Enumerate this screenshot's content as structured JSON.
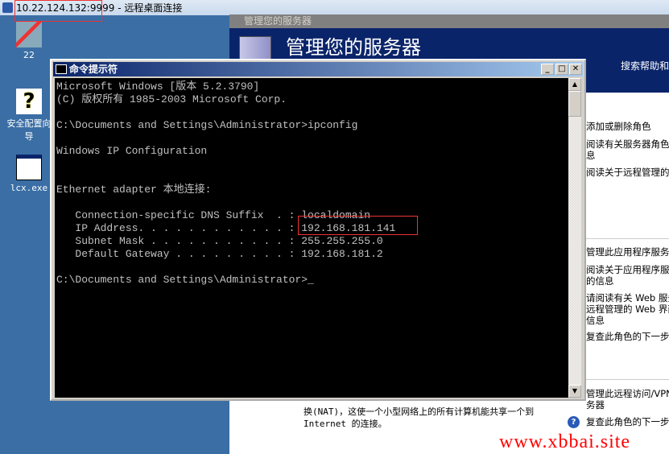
{
  "rdp": {
    "title": "10.22.124.132:9999 - 远程桌面连接"
  },
  "desktop": {
    "icons": [
      {
        "label": "22",
        "icon": "network-computer-icon"
      },
      {
        "label": "安全配置向导",
        "icon": "security-wizard-icon"
      },
      {
        "label": "lcx.exe",
        "icon": "exe-window-icon"
      }
    ]
  },
  "server_manager": {
    "window_title": "管理您的服务器",
    "heading": "管理您的服务器",
    "search_help": "搜索帮助和",
    "right_links": [
      "添加或删除角色",
      "阅读有关服务器角色",
      "息",
      "阅读关于远程管理的",
      "管理此应用程序服务",
      "阅读关于应用程序服",
      "的信息",
      "请阅读有关 Web 服务",
      "远程管理的 Web 界面",
      "信息",
      "复查此角色的下一步",
      "管理此远程访问/VPN",
      "务器",
      "复查此角色的下一步"
    ],
    "bottom_text": [
      "换(NAT)，这使一个小型网络上的所有计算机能共享一个到",
      "Internet 的连接。"
    ]
  },
  "cmd": {
    "title": "命令提示符",
    "lines": [
      "Microsoft Windows [版本 5.2.3790]",
      "(C) 版权所有 1985-2003 Microsoft Corp.",
      "",
      "C:\\Documents and Settings\\Administrator>ipconfig",
      "",
      "Windows IP Configuration",
      "",
      "",
      "Ethernet adapter 本地连接:",
      "",
      "   Connection-specific DNS Suffix  . : localdomain",
      "   IP Address. . . . . . . . . . . . : 192.168.181.141",
      "   Subnet Mask . . . . . . . . . . . : 255.255.255.0",
      "   Default Gateway . . . . . . . . . : 192.168.181.2",
      "",
      "C:\\Documents and Settings\\Administrator>_"
    ]
  },
  "watermark": "www.xbbai.site",
  "colors": {
    "desktop": "#3a6ea5",
    "header": "#0a246a",
    "highlight": "#e33333"
  }
}
